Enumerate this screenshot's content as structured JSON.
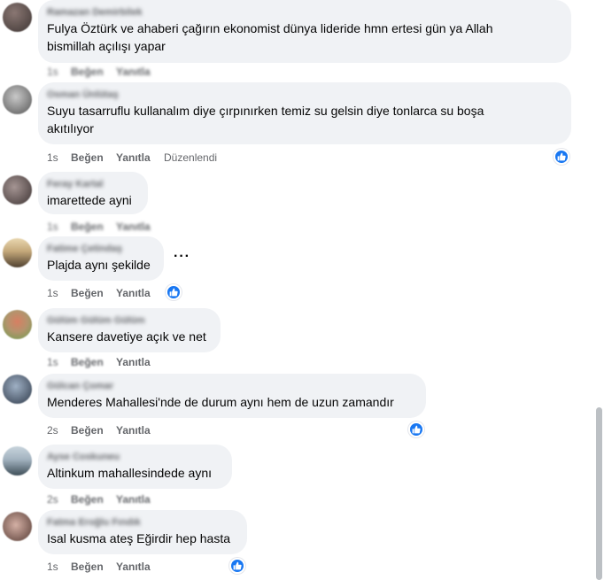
{
  "labels": {
    "like": "Beğen",
    "reply": "Yanıtla",
    "edited": "Düzenlendi"
  },
  "colors": {
    "like_blue": "#1877f2",
    "bubble_bg": "#f0f2f5",
    "meta_gray": "#65676b"
  },
  "comments": [
    {
      "author": "Ramazan Demirbilek",
      "lines": [
        "Fulya Öztürk ve ahaberi çağırın ekonomist dünya lideride hmn ertesi gün ya Allah",
        "bismillah açılışı yapar"
      ],
      "time": "1s",
      "edited": "",
      "liked": false,
      "avatar_colors": [
        "#6b5a55",
        "#3e3634"
      ]
    },
    {
      "author": "Osman Ünlütaş",
      "lines": [
        "Suyu tasarruflu kullanalım diye çırpınırken temiz su gelsin diye tonlarca su boşa",
        "akıtılıyor"
      ],
      "time": "1s",
      "edited": "Düzenlendi",
      "liked": true,
      "avatar_colors": [
        "#9a9a9a",
        "#555"
      ]
    },
    {
      "author": "Feray Kartal",
      "lines": [
        "imarettede ayni"
      ],
      "time": "1s",
      "edited": "",
      "liked": false,
      "avatar_colors": [
        "#7e6f6d",
        "#3d3333"
      ]
    },
    {
      "author": "Fatime Çetindaş",
      "lines": [
        "Plajda aynı şekilde"
      ],
      "time": "1s",
      "edited": "",
      "liked": true,
      "avatar_colors": [
        "#c4a87a",
        "#4f4030"
      ]
    },
    {
      "author": "Gülüm Gülüm Gülüm",
      "lines": [
        "Kansere davetiye açık ve net"
      ],
      "time": "1s",
      "edited": "",
      "liked": false,
      "avatar_colors": [
        "#d77f62",
        "#6c9e4e"
      ]
    },
    {
      "author": "Gülcan Çomar",
      "lines": [
        "Menderes Mahallesi'nde de durum aynı hem de uzun zamandır"
      ],
      "time": "2s",
      "edited": "",
      "liked": true,
      "avatar_colors": [
        "#7d8ca0",
        "#2f3a4a"
      ]
    },
    {
      "author": "Ayse Coskuneu",
      "lines": [
        "Altinkum mahallesindede aynı"
      ],
      "time": "2s",
      "edited": "",
      "liked": false,
      "avatar_colors": [
        "#a3b3c0",
        "#3e4e58"
      ]
    },
    {
      "author": "Fatma Eroğlu Fındık",
      "lines": [
        "Isal kusma ateş Eğirdir hep hasta"
      ],
      "time": "1s",
      "edited": "",
      "liked": true,
      "avatar_colors": [
        "#b88b7c",
        "#553a33"
      ]
    }
  ],
  "more_options_icon": "ellipsis-icon",
  "like_icon": "thumbs-up-icon"
}
